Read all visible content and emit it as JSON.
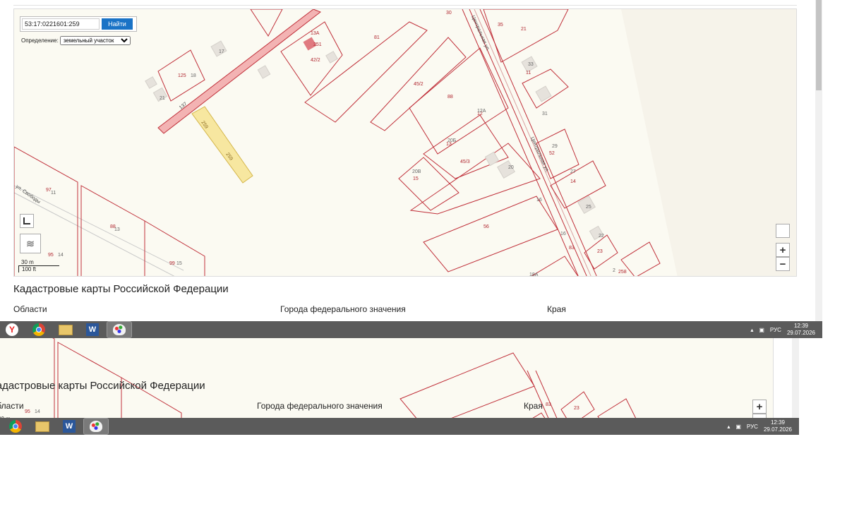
{
  "search": {
    "value": "53:17:0221601:259",
    "button_label": "Найти"
  },
  "definition": {
    "label": "Определение:",
    "selected": "земельный участок"
  },
  "map": {
    "street_labels": [
      "ул. Свободы",
      "Центральная ул."
    ],
    "parcel_labels": [
      "30",
      "35",
      "21",
      "13А",
      "81",
      "17",
      "251",
      "42/2",
      "125",
      "18",
      "33",
      "11",
      "21",
      "45/2",
      "88",
      "137",
      "31",
      "259",
      "259",
      "12А",
      "12",
      "20Б",
      "13",
      "29",
      "52",
      "20В",
      "15",
      "45/3",
      "20",
      "27",
      "14",
      "97",
      "11",
      "16",
      "25",
      "88",
      "13",
      "56",
      "16",
      "22",
      "83",
      "95",
      "14",
      "99",
      "15",
      "23",
      "30 m",
      "2",
      "258",
      "18А"
    ],
    "scale": {
      "metric": "30 m",
      "imperial": "100 ft"
    },
    "zoom_in": "+",
    "zoom_out": "−"
  },
  "footer": {
    "heading": "Кадастровые карты Российской Федерации",
    "columns": [
      "Области",
      "Города федерального значения",
      "Края"
    ]
  },
  "taskbar": {
    "apps": [
      "yandex-browser",
      "chrome",
      "file-explorer",
      "word",
      "paint"
    ],
    "lang": "РУС",
    "time": "12:39",
    "date": "29.07.2026"
  },
  "colors": {
    "parcel_line": "#c0303a",
    "highlight_parcel": "#f7e7a0",
    "road": "#f0b6b6",
    "button": "#1a73c6",
    "taskbar": "#5b5b5b"
  }
}
